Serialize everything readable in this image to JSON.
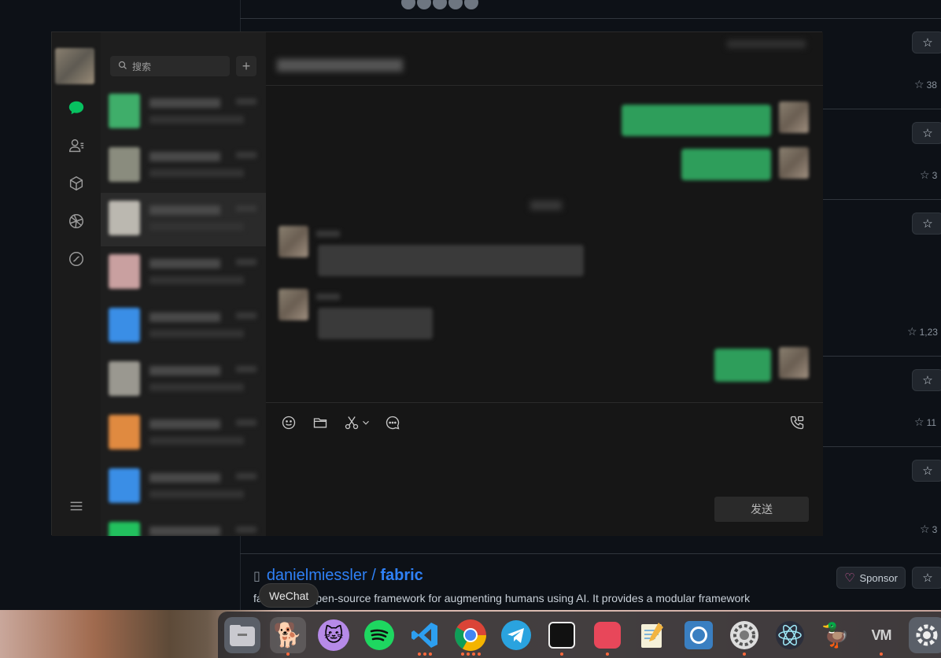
{
  "background_page": {
    "star_counts": [
      "38",
      "3",
      "1,23",
      "11",
      "3"
    ],
    "repo": {
      "owner": "danielmiessler",
      "separator": " / ",
      "name": "fabric",
      "description": "fabric is an open-source framework for augmenting humans using AI. It provides a modular framework",
      "sponsor_label": "Sponsor"
    }
  },
  "wechat": {
    "search_placeholder": "搜索",
    "plus_label": "+",
    "send_label": "发送",
    "nav": [
      {
        "name": "chat-icon",
        "active": true
      },
      {
        "name": "contacts-icon"
      },
      {
        "name": "favorites-cube-icon"
      },
      {
        "name": "moments-icon"
      },
      {
        "name": "channels-icon"
      }
    ],
    "menu_icon": "hamburger-menu-icon",
    "sessions": [
      {
        "avatar_color": "#3fae6a"
      },
      {
        "avatar_color": "#8a8c7e"
      },
      {
        "avatar_color": "#bbb8b0",
        "selected": true
      },
      {
        "avatar_color": "#c9a0a0"
      },
      {
        "avatar_color": "#3a8ee6"
      },
      {
        "avatar_color": "#9a9890"
      },
      {
        "avatar_color": "#e08a40"
      },
      {
        "avatar_color": "#3a8ee6"
      },
      {
        "avatar_color": "#22c05e"
      }
    ],
    "toolbar": [
      "emoji-icon",
      "folder-icon",
      "scissors-icon",
      "chevron-down-icon",
      "chat-bubble-icon"
    ],
    "call_icon": "voice-call-icon"
  },
  "tooltip": "WeChat",
  "dock": {
    "apps": [
      "Files",
      "WeChat",
      "Cat app",
      "Spotify",
      "VS Code",
      "Chrome",
      "Telegram",
      "Notion",
      "App",
      "Text editor",
      "App",
      "Settings",
      "Electron",
      "Duck",
      "VM",
      "Settings"
    ]
  },
  "colors": {
    "accent_green": "#07c160",
    "link_blue": "#2f81f7"
  }
}
